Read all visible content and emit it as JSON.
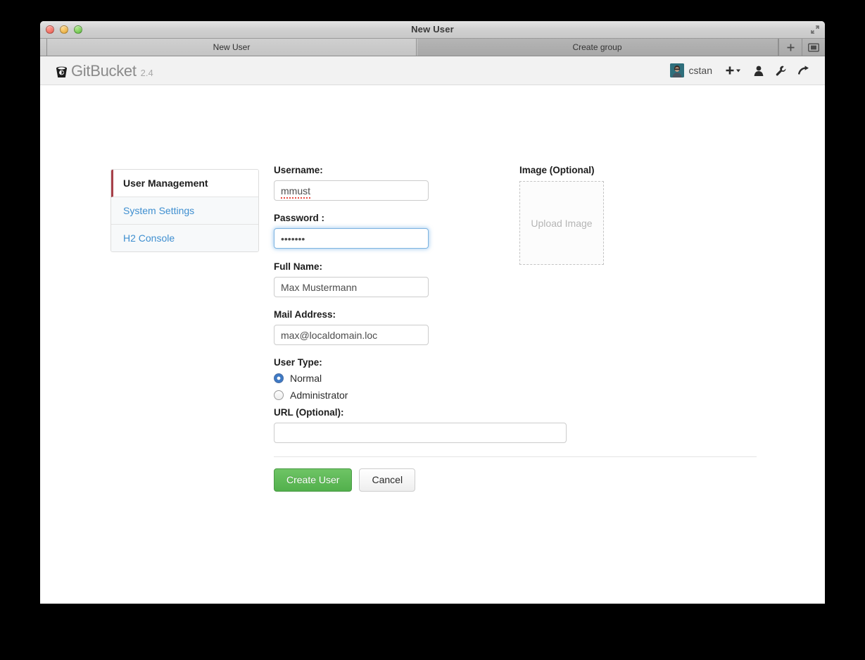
{
  "window": {
    "title": "New User",
    "controls": {
      "close": "close",
      "minimize": "minimize",
      "maximize": "maximize"
    },
    "fullscreen_icon": "fullscreen-expand-icon"
  },
  "tabs": {
    "items": [
      {
        "label": "New User",
        "active": true
      },
      {
        "label": "Create group",
        "active": false
      }
    ],
    "new_tab_icon": "plus-icon",
    "tab_overview_icon": "tab-overview-icon"
  },
  "app_header": {
    "logo_icon": "gitbucket-bucket-logo-icon",
    "brand": "GitBucket",
    "version": "2.4",
    "user": {
      "avatar_icon": "user-avatar",
      "name": "cstan"
    },
    "actions": [
      {
        "icon": "plus-dropdown-icon",
        "name": "create-new-menu"
      },
      {
        "icon": "person-icon",
        "name": "account-settings"
      },
      {
        "icon": "wrench-icon",
        "name": "administration"
      },
      {
        "icon": "sign-out-arrow-icon",
        "name": "sign-out"
      }
    ]
  },
  "sidebar": {
    "items": [
      {
        "label": "User Management",
        "active": true
      },
      {
        "label": "System Settings",
        "active": false
      },
      {
        "label": "H2 Console",
        "active": false
      }
    ],
    "active_accent": "#a8414a"
  },
  "form": {
    "username": {
      "label": "Username:",
      "value": "mmust",
      "placeholder": "",
      "spellcheck_error": true
    },
    "password": {
      "label": "Password :",
      "value": "•••••••",
      "placeholder": "",
      "focused": true
    },
    "full_name": {
      "label": "Full Name:",
      "value": "Max Mustermann",
      "placeholder": ""
    },
    "mail_address": {
      "label": "Mail Address:",
      "value": "max@localdomain.loc",
      "placeholder": ""
    },
    "user_type": {
      "label": "User Type:",
      "options": [
        {
          "label": "Normal",
          "selected": true
        },
        {
          "label": "Administrator",
          "selected": false
        }
      ]
    },
    "url": {
      "label": "URL (Optional):",
      "value": "",
      "placeholder": ""
    },
    "buttons": {
      "submit": "Create User",
      "cancel": "Cancel",
      "submit_color": "#52b04c"
    }
  },
  "image_upload": {
    "label": "Image (Optional)",
    "drop_text": "Upload Image"
  }
}
